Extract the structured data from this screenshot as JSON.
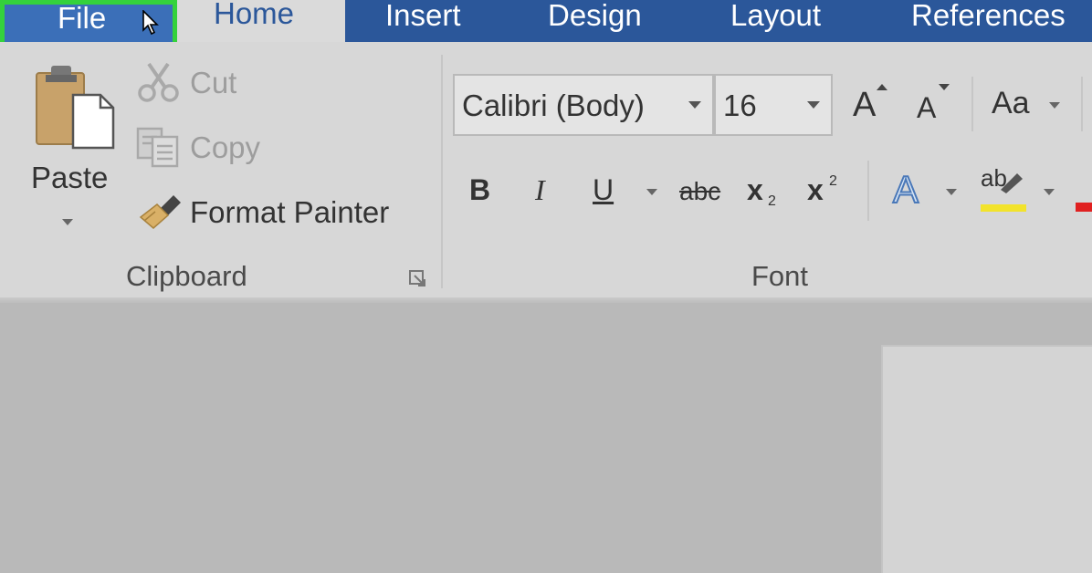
{
  "tabs": {
    "file": "File",
    "home": "Home",
    "insert": "Insert",
    "design": "Design",
    "layout": "Layout",
    "references": "References"
  },
  "clipboard": {
    "paste": "Paste",
    "cut": "Cut",
    "copy": "Copy",
    "format_painter": "Format Painter",
    "group_label": "Clipboard"
  },
  "font": {
    "font_name": "Calibri (Body)",
    "font_size": "16",
    "grow_font": "A",
    "shrink_font": "A",
    "change_case": "Aa",
    "bold": "B",
    "italic": "I",
    "underline": "U",
    "strikethrough": "abc",
    "subscript": "x",
    "subscript_mark": "2",
    "superscript": "x",
    "superscript_mark": "2",
    "text_effects": "A",
    "highlight": "ab",
    "group_label": "Font"
  },
  "colors": {
    "tab_bar": "#2b579a",
    "file_highlight": "#34d23c",
    "ribbon": "#d7d7d7",
    "highlight_yellow": "#f2e32b",
    "font_color_red": "#e02020"
  }
}
